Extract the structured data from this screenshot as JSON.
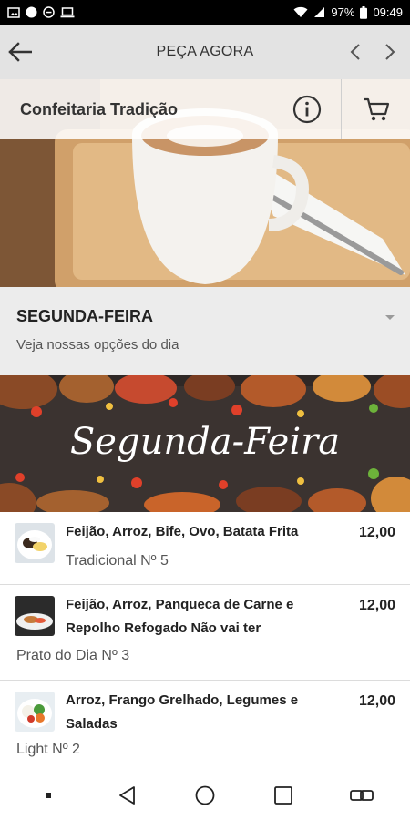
{
  "status": {
    "battery": "97%",
    "time": "09:49"
  },
  "app_bar": {
    "title": "PEÇA AGORA"
  },
  "store": {
    "name": "Confeitaria Tradição"
  },
  "menu": {
    "day": "SEGUNDA-FEIRA",
    "subtitle": "Veja nossas opções do dia",
    "banner_text": "Segunda-Feira"
  },
  "items": [
    {
      "name": "Feijão, Arroz, Bife, Ovo, Batata Frita",
      "price": "12,00",
      "code": "Tradicional Nº 5"
    },
    {
      "name": "Feijão, Arroz, Panqueca de Carne e Repolho Refogado Não vai ter",
      "price": "12,00",
      "code": "Prato do Dia Nº 3"
    },
    {
      "name": "Arroz, Frango Grelhado, Legumes e Saladas",
      "price": "12,00",
      "code": "Light Nº 2"
    }
  ],
  "icons": {
    "back": "arrow-left-icon",
    "prev": "chevron-left-icon",
    "next": "chevron-right-icon",
    "info": "info-icon",
    "cart": "cart-icon",
    "expand": "caret-down-icon"
  }
}
